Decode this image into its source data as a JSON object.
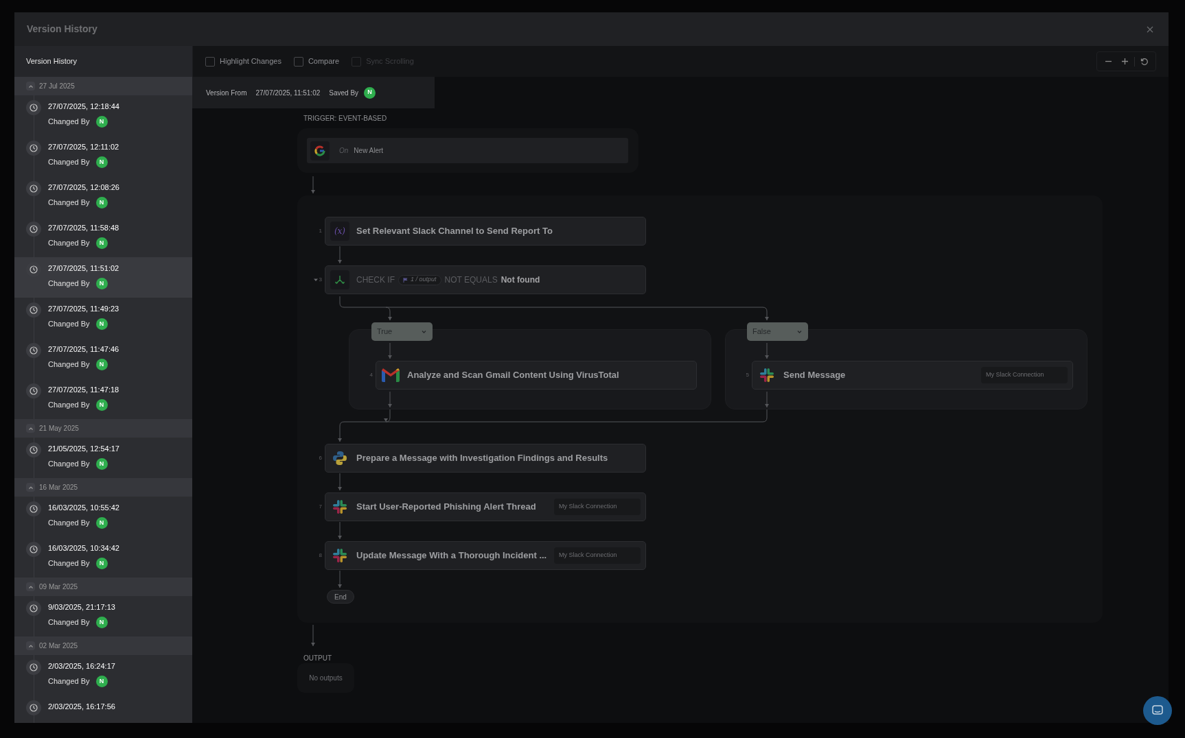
{
  "dialog": {
    "title": "Version History"
  },
  "sidebar": {
    "title": "Version History",
    "groups": [
      {
        "label": "27 Jul 2025",
        "expanded": true,
        "versions": [
          {
            "timestamp": "27/07/2025, 12:18:44",
            "changed_by": "Changed By",
            "avatar": "N",
            "selected": false
          },
          {
            "timestamp": "27/07/2025, 12:11:02",
            "changed_by": "Changed By",
            "avatar": "N",
            "selected": false
          },
          {
            "timestamp": "27/07/2025, 12:08:26",
            "changed_by": "Changed By",
            "avatar": "N",
            "selected": false
          },
          {
            "timestamp": "27/07/2025, 11:58:48",
            "changed_by": "Changed By",
            "avatar": "N",
            "selected": false
          },
          {
            "timestamp": "27/07/2025, 11:51:02",
            "changed_by": "Changed By",
            "avatar": "N",
            "selected": true
          },
          {
            "timestamp": "27/07/2025, 11:49:23",
            "changed_by": "Changed By",
            "avatar": "N",
            "selected": false
          },
          {
            "timestamp": "27/07/2025, 11:47:46",
            "changed_by": "Changed By",
            "avatar": "N",
            "selected": false
          },
          {
            "timestamp": "27/07/2025, 11:47:18",
            "changed_by": "Changed By",
            "avatar": "N",
            "selected": false
          }
        ]
      },
      {
        "label": "21 May 2025",
        "expanded": true,
        "versions": [
          {
            "timestamp": "21/05/2025, 12:54:17",
            "changed_by": "Changed By",
            "avatar": "N",
            "selected": false
          }
        ]
      },
      {
        "label": "16 Mar 2025",
        "expanded": true,
        "versions": [
          {
            "timestamp": "16/03/2025, 10:55:42",
            "changed_by": "Changed By",
            "avatar": "N",
            "selected": false
          },
          {
            "timestamp": "16/03/2025, 10:34:42",
            "changed_by": "Changed By",
            "avatar": "N",
            "selected": false
          }
        ]
      },
      {
        "label": "09 Mar 2025",
        "expanded": true,
        "versions": [
          {
            "timestamp": "9/03/2025, 21:17:13",
            "changed_by": "Changed By",
            "avatar": "N",
            "selected": false
          }
        ]
      },
      {
        "label": "02 Mar 2025",
        "expanded": true,
        "versions": [
          {
            "timestamp": "2/03/2025, 16:24:17",
            "changed_by": "Changed By",
            "avatar": "N",
            "selected": false
          },
          {
            "timestamp": "2/03/2025, 16:17:56",
            "selected": false
          }
        ]
      }
    ]
  },
  "toolbar": {
    "options": [
      {
        "label": "Highlight Changes",
        "checked": false,
        "disabled": false
      },
      {
        "label": "Compare",
        "checked": false,
        "disabled": false
      },
      {
        "label": "Sync Scrolling",
        "checked": false,
        "disabled": true
      }
    ]
  },
  "version_info": {
    "label": "Version From",
    "timestamp": "27/07/2025, 11:51:02",
    "saved_by_label": "Saved By",
    "avatar": "N"
  },
  "workflow": {
    "trigger_label": "TRIGGER: EVENT-BASED",
    "trigger": {
      "prefix": "On",
      "event": "New Alert"
    },
    "steps": [
      {
        "kind": "variable",
        "number": "1",
        "icon_text": "(x)",
        "title": "Set Relevant Slack Channel to Send Report To"
      },
      {
        "kind": "condition",
        "number": "3",
        "expanded": true,
        "keyword": "CHECK IF",
        "variable": "1 / output",
        "operator": "NOT EQUALS",
        "value": "Not found"
      },
      {
        "kind": "gmail",
        "number": "4",
        "title": "Analyze and Scan Gmail Content Using VirusTotal"
      },
      {
        "kind": "slack",
        "number": "5",
        "title": "Send Message",
        "connection": "My Slack Connection"
      },
      {
        "kind": "python",
        "number": "6",
        "title": "Prepare a Message with Investigation Findings and Results"
      },
      {
        "kind": "slack",
        "number": "7",
        "title": "Start User-Reported Phishing Alert Thread",
        "connection": "My Slack Connection"
      },
      {
        "kind": "slack",
        "number": "8",
        "title": "Update Message With a Thorough Incident ...",
        "connection": "My Slack Connection"
      }
    ],
    "branches": [
      {
        "label": "True"
      },
      {
        "label": "False"
      }
    ],
    "end_label": "End",
    "output_label": "OUTPUT",
    "output_empty": "No outputs"
  }
}
